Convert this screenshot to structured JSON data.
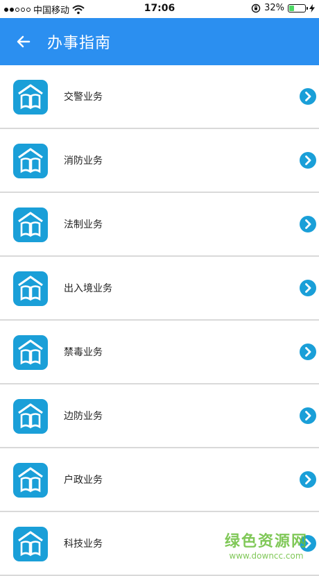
{
  "status_bar": {
    "carrier": "中国移动",
    "time": "17:06",
    "battery_percent": "32%",
    "battery_level": 0.32,
    "signal_bars_filled": 2,
    "signal_bars_total": 5
  },
  "header": {
    "title": "办事指南",
    "back_icon": "arrow-left-icon",
    "background_color": "#2b8ff0"
  },
  "list": {
    "items": [
      {
        "label": "交警业务",
        "icon": "book-house-icon"
      },
      {
        "label": "消防业务",
        "icon": "book-house-icon"
      },
      {
        "label": "法制业务",
        "icon": "book-house-icon"
      },
      {
        "label": "出入境业务",
        "icon": "book-house-icon"
      },
      {
        "label": "禁毒业务",
        "icon": "book-house-icon"
      },
      {
        "label": "边防业务",
        "icon": "book-house-icon"
      },
      {
        "label": "户政业务",
        "icon": "book-house-icon"
      },
      {
        "label": "科技业务",
        "icon": "book-house-icon"
      }
    ],
    "chevron_icon": "chevron-right-circle-icon",
    "accent_color": "#1a9fd8"
  },
  "watermark": {
    "main": "绿色资源网",
    "url": "www.downcc.com"
  }
}
